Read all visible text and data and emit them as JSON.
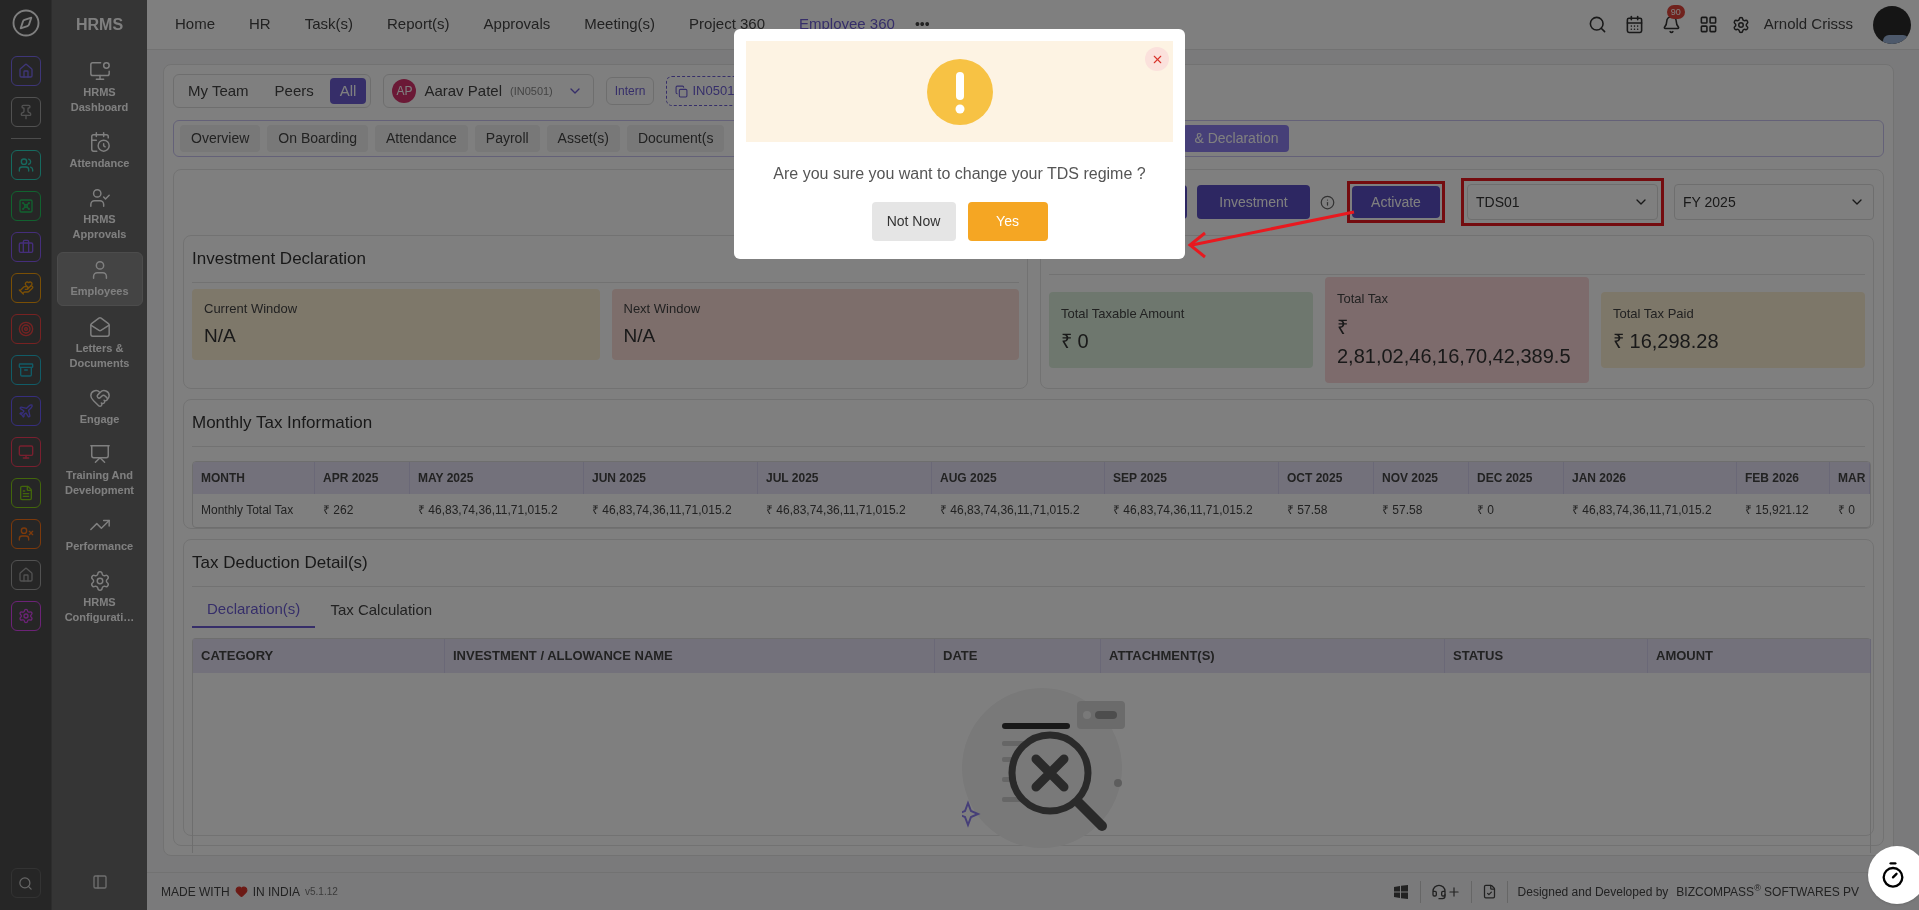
{
  "sidebar": {
    "title": "HRMS",
    "items": [
      {
        "label": "HRMS Dashboard",
        "selected": false
      },
      {
        "label": "Attendance",
        "selected": false
      },
      {
        "label": "HRMS Approvals",
        "selected": false
      },
      {
        "label": "Employees",
        "selected": true
      },
      {
        "label": "Letters & Documents",
        "selected": false
      },
      {
        "label": "Engage",
        "selected": false
      },
      {
        "label": "Training And Development",
        "selected": false
      },
      {
        "label": "Performance",
        "selected": false
      },
      {
        "label": "HRMS Configurati…",
        "selected": false
      }
    ]
  },
  "nav": {
    "items": [
      {
        "label": "Home",
        "selected": false
      },
      {
        "label": "HR",
        "selected": false
      },
      {
        "label": "Task(s)",
        "selected": false
      },
      {
        "label": "Report(s)",
        "selected": false
      },
      {
        "label": "Approvals",
        "selected": false
      },
      {
        "label": "Meeting(s)",
        "selected": false
      },
      {
        "label": "Project 360",
        "selected": false
      },
      {
        "label": "Employee 360",
        "selected": true
      }
    ],
    "more": "•••"
  },
  "header": {
    "notification_count": "90",
    "user_name": "Arnold Crisss"
  },
  "filter": {
    "scope": [
      {
        "label": "My Team",
        "selected": false
      },
      {
        "label": "Peers",
        "selected": false
      },
      {
        "label": "All",
        "selected": true
      }
    ],
    "employee": {
      "initials": "AP",
      "name": "Aarav Patel",
      "code": "(IN0501)"
    },
    "type_tag": "Intern",
    "id_tag": "IN0501"
  },
  "tabs": [
    {
      "label": "Overview",
      "selected": false
    },
    {
      "label": "On Boarding",
      "selected": false
    },
    {
      "label": "Attendance",
      "selected": false
    },
    {
      "label": "Payroll",
      "selected": false
    },
    {
      "label": "Asset(s)",
      "selected": false
    },
    {
      "label": "Document(s",
      "selected": false
    },
    {
      "label": "& Declaration",
      "selected": true
    }
  ],
  "actions": {
    "investment": "Investment",
    "activate": "Activate",
    "regime_select": "TDS01",
    "year_select": "FY 2025"
  },
  "investment_declaration": {
    "title": "Investment Declaration",
    "windows": [
      {
        "label": "Current Window",
        "value": "N/A"
      },
      {
        "label": "Next Window",
        "value": "N/A"
      }
    ]
  },
  "tax_summary": [
    {
      "label": "Total Taxable Amount",
      "value": "₹ 0"
    },
    {
      "label": "Total Tax",
      "value": "₹ 2,81,02,46,16,70,42,389.5"
    },
    {
      "label": "Total Tax Paid",
      "value": "₹ 16,298.28"
    }
  ],
  "monthly_tax": {
    "title": "Monthly Tax Information",
    "columns": [
      "MONTH",
      "APR 2025",
      "MAY 2025",
      "JUN 2025",
      "JUL 2025",
      "AUG 2025",
      "SEP 2025",
      "OCT 2025",
      "NOV 2025",
      "DEC 2025",
      "JAN 2026",
      "FEB 2026",
      "MAR"
    ],
    "rows": [
      [
        "Monthly Total Tax",
        "₹ 262",
        "₹ 46,83,74,36,11,71,015.2",
        "₹ 46,83,74,36,11,71,015.2",
        "₹ 46,83,74,36,11,71,015.2",
        "₹ 46,83,74,36,11,71,015.2",
        "₹ 46,83,74,36,11,71,015.2",
        "₹ 57.58",
        "₹ 57.58",
        "₹ 0",
        "₹ 46,83,74,36,11,71,015.2",
        "₹ 15,921.12",
        "₹ 0"
      ]
    ]
  },
  "tax_deduction": {
    "title": "Tax Deduction Detail(s)",
    "tabs": [
      {
        "label": "Declaration(s)",
        "selected": true
      },
      {
        "label": "Tax Calculation",
        "selected": false
      }
    ],
    "columns": [
      "CATEGORY",
      "INVESTMENT / ALLOWANCE NAME",
      "DATE",
      "ATTACHMENT(S)",
      "STATUS",
      "AMOUNT"
    ]
  },
  "modal": {
    "message": "Are you sure you want to change your TDS regime ?",
    "buttons": [
      {
        "label": "Not Now",
        "kind": "secondary"
      },
      {
        "label": "Yes",
        "kind": "primary"
      }
    ]
  },
  "footer": {
    "made_with": "MADE WITH",
    "in_india": "IN INDIA",
    "version": "v5.1.12",
    "credit": "Designed and Developed by",
    "company": "BIZCOMPASS$^{®}$ SOFTWARES PV"
  }
}
